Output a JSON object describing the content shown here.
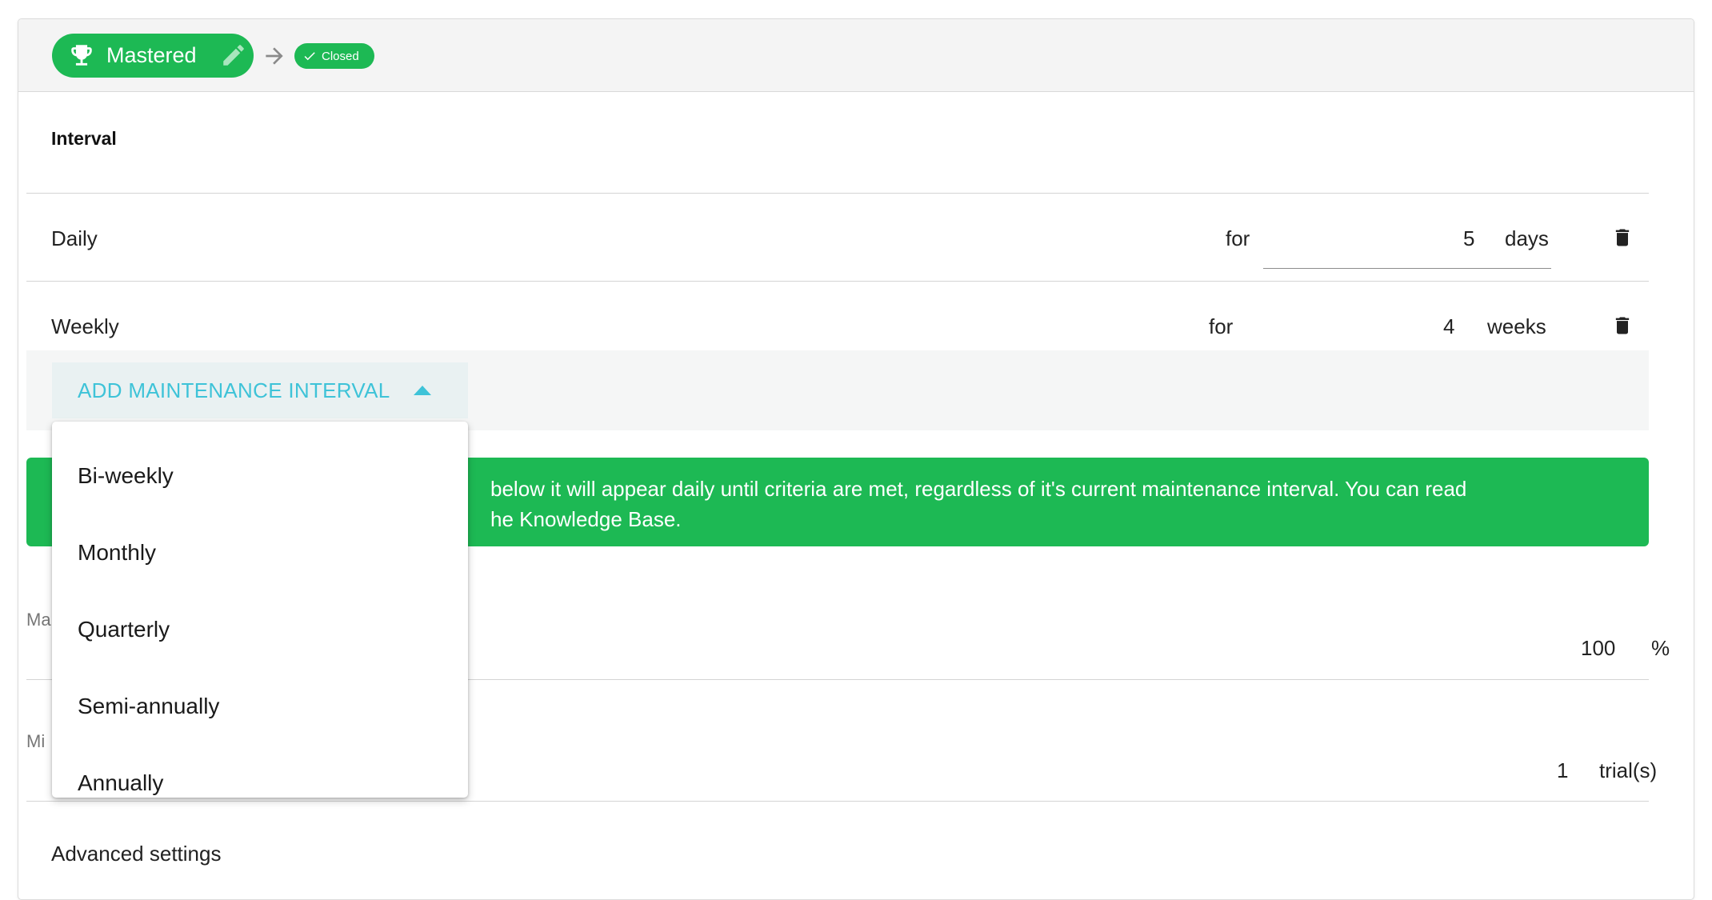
{
  "header": {
    "stage_label": "Mastered",
    "status_label": "Closed",
    "colors": {
      "chip": "#1db954",
      "accent": "#3ec3d8"
    }
  },
  "interval_section": {
    "title": "Interval",
    "rows": [
      {
        "name": "Daily",
        "for": "for",
        "value": "5",
        "unit": "days"
      },
      {
        "name": "Weekly",
        "for": "for",
        "value": "4",
        "unit": "weeks"
      }
    ],
    "add_button_label": "ADD MAINTENANCE INTERVAL",
    "dropdown_options": [
      "Bi-weekly",
      "Monthly",
      "Quarterly",
      "Semi-annually",
      "Annually"
    ]
  },
  "banner": {
    "line1": "below it will appear daily until criteria are met, regardless of it's current maintenance interval. You can read",
    "line2": "he Knowledge Base."
  },
  "fields": [
    {
      "label_visible": "Ma",
      "value": "100",
      "unit": "%"
    },
    {
      "label_visible": "Mi",
      "value": "1",
      "unit": "trial(s)"
    }
  ],
  "advanced": {
    "label": "Advanced settings"
  }
}
